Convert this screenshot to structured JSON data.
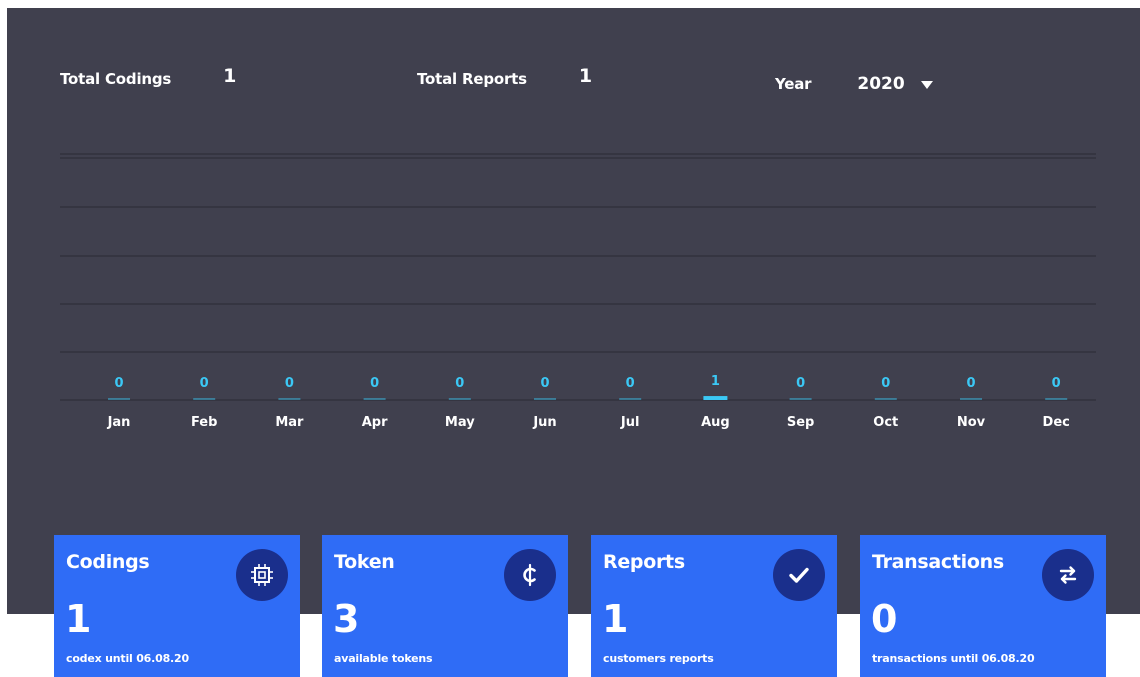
{
  "stats": {
    "total_codings_label": "Total Codings",
    "total_codings_value": "1",
    "total_reports_label": "Total Reports",
    "total_reports_value": "1",
    "year_label": "Year",
    "year_value": "2020"
  },
  "chart_data": {
    "type": "bar",
    "categories": [
      "Jan",
      "Feb",
      "Mar",
      "Apr",
      "May",
      "Jun",
      "Jul",
      "Aug",
      "Sep",
      "Oct",
      "Nov",
      "Dec"
    ],
    "values": [
      0,
      0,
      0,
      0,
      0,
      0,
      0,
      1,
      0,
      0,
      0,
      0
    ],
    "title": "",
    "xlabel": "",
    "ylabel": "",
    "grid": true,
    "colors": {
      "bar": "#3bc8f5",
      "label": "#3bc8f5",
      "grid": "#2a2a34",
      "axis_text": "#ffffff"
    }
  },
  "cards": [
    {
      "title": "Codings",
      "value": "1",
      "caption": "codex until 06.08.20",
      "icon": "chip-icon"
    },
    {
      "title": "Token",
      "value": "3",
      "caption": "available tokens",
      "icon": "cent-icon"
    },
    {
      "title": "Reports",
      "value": "1",
      "caption": "customers reports",
      "icon": "check-icon"
    },
    {
      "title": "Transactions",
      "value": "0",
      "caption": "transactions until 06.08.20",
      "icon": "swap-arrows-icon"
    }
  ],
  "colors": {
    "panel_bg": "#40404e",
    "card_bg": "#2f6cf6",
    "card_icon_bg": "#1a2f8c",
    "accent": "#3bc8f5"
  }
}
